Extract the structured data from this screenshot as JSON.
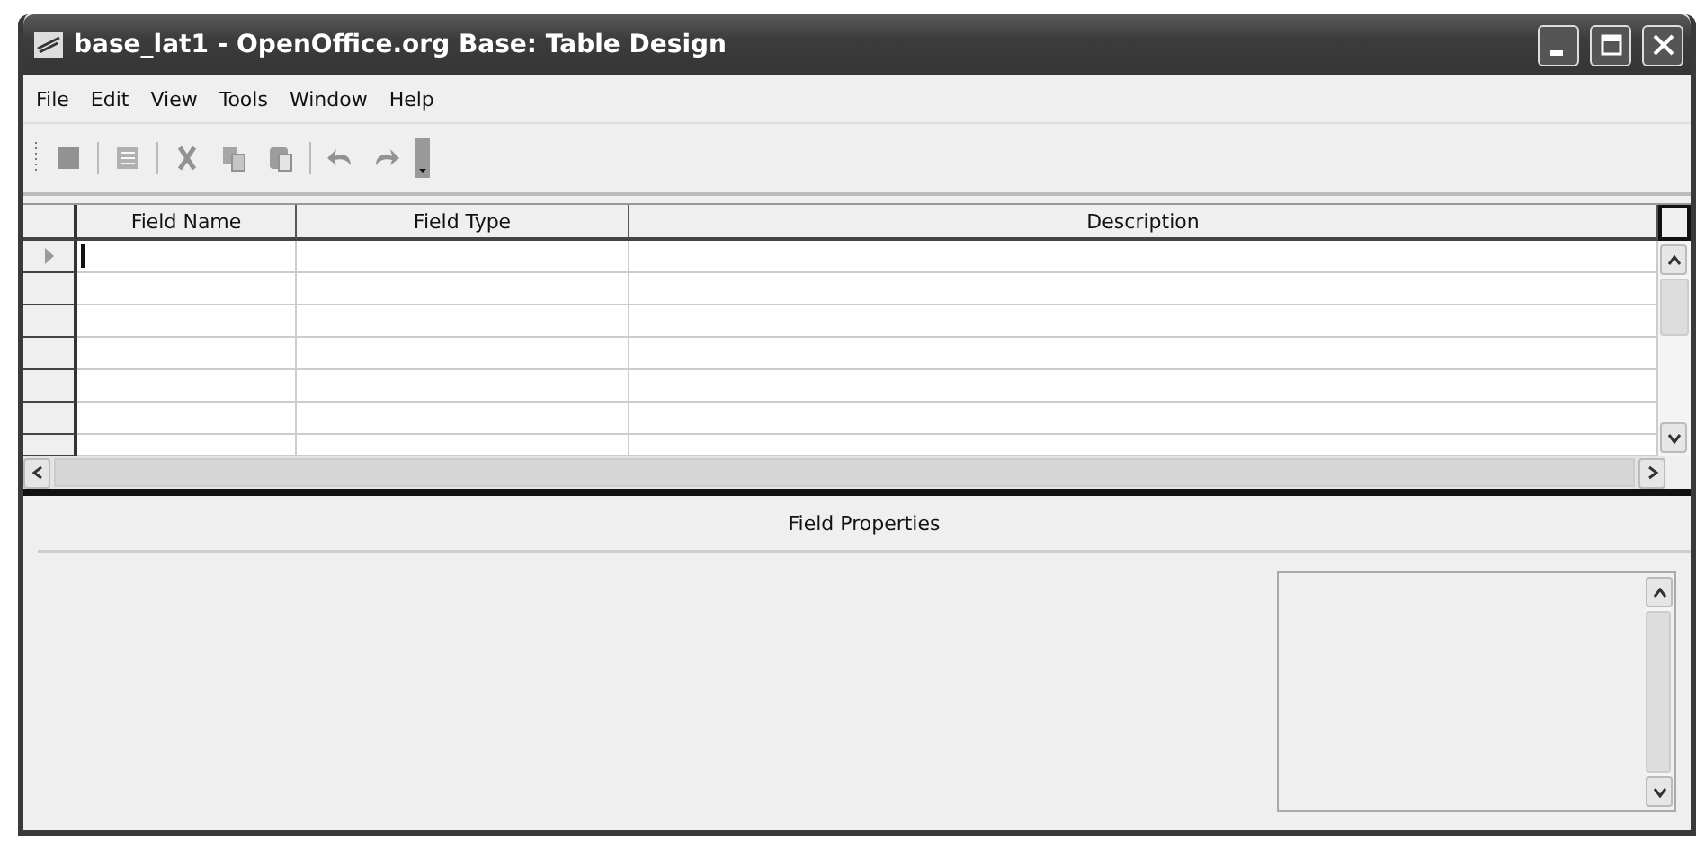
{
  "window": {
    "title": "base_lat1 - OpenOffice.org Base: Table Design"
  },
  "menu": [
    "File",
    "Edit",
    "View",
    "Tools",
    "Window",
    "Help"
  ],
  "toolbar": [
    {
      "kind": "save",
      "disabled": true
    },
    {
      "kind": "sep"
    },
    {
      "kind": "edit",
      "disabled": true
    },
    {
      "kind": "sep"
    },
    {
      "kind": "cut",
      "disabled": true
    },
    {
      "kind": "copy",
      "disabled": true
    },
    {
      "kind": "paste",
      "disabled": true
    },
    {
      "kind": "sep"
    },
    {
      "kind": "undo",
      "disabled": true
    },
    {
      "kind": "redo",
      "disabled": true
    }
  ],
  "table": {
    "columns": [
      "Field Name",
      "Field Type",
      "Description"
    ],
    "rows": [
      {
        "selected": true
      },
      {
        "selected": false
      },
      {
        "selected": false
      },
      {
        "selected": false
      },
      {
        "selected": false
      },
      {
        "selected": false
      },
      {
        "selected": false
      }
    ]
  },
  "properties": {
    "title": "Field Properties"
  }
}
